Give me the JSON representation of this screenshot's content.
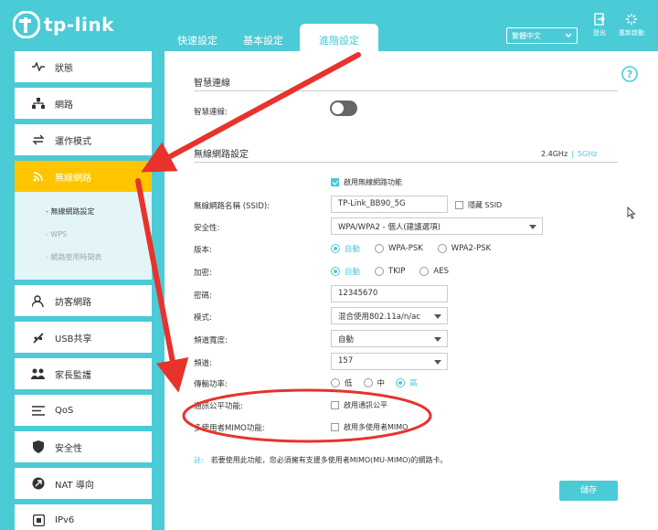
{
  "header": {
    "brand": "tp-link",
    "tabs": [
      "快速設定",
      "基本設定",
      "進階設定"
    ],
    "language": "繁體中文",
    "logout_label": "登出",
    "reboot_label": "重新啟動"
  },
  "sidebar": {
    "items": [
      {
        "label": "狀態",
        "icon": "pulse-icon"
      },
      {
        "label": "網路",
        "icon": "network-icon"
      },
      {
        "label": "運作模式",
        "icon": "mode-icon"
      },
      {
        "label": "無線網路",
        "icon": "wifi-icon"
      },
      {
        "label": "訪客網路",
        "icon": "guest-icon"
      },
      {
        "label": "USB共享",
        "icon": "usb-icon"
      },
      {
        "label": "家長監護",
        "icon": "parental-icon"
      },
      {
        "label": "QoS",
        "icon": "qos-icon"
      },
      {
        "label": "安全性",
        "icon": "shield-icon"
      },
      {
        "label": "NAT 導向",
        "icon": "nat-icon"
      },
      {
        "label": "IPv6",
        "icon": "ipv6-icon"
      }
    ],
    "submenu": [
      "- 無線網路設定",
      "- WPS",
      "- 網路使用時間表"
    ]
  },
  "smart_connect": {
    "title": "智慧連線",
    "label": "智慧連線:"
  },
  "wireless": {
    "title": "無線網路設定",
    "band_24": "2.4GHz",
    "band_sep": "|",
    "band_5": "5GHz",
    "enable_label": "啟用無線網路功能",
    "ssid_label": "無線網路名稱 (SSID):",
    "ssid_value": "TP-Link_BB90_5G",
    "hide_ssid_label": "隱藏 SSID",
    "security_label": "安全性:",
    "security_value": "WPA/WPA2 - 個人(建議選項)",
    "version_label": "版本:",
    "version_options": [
      "自動",
      "WPA-PSK",
      "WPA2-PSK"
    ],
    "encryption_label": "加密:",
    "encryption_options": [
      "自動",
      "TKIP",
      "AES"
    ],
    "password_label": "密碼:",
    "password_value": "12345670",
    "mode_label": "模式:",
    "mode_value": "混合使用802.11a/n/ac",
    "width_label": "頻道寬度:",
    "width_value": "自動",
    "channel_label": "頻道:",
    "channel_value": "157",
    "power_label": "傳輸功率:",
    "power_options": [
      "低",
      "中",
      "高"
    ],
    "airtime_label": "通訊公平功能:",
    "airtime_check": "啟用通訊公平",
    "mumimo_label": "多使用者MIMO功能:",
    "mumimo_check": "啟用多使用者MIMO"
  },
  "note": {
    "prefix": "註:",
    "text": "若要使用此功能，您必須擁有支援多使用者MIMO(MU-MIMO)的網路卡。"
  },
  "save_label": "儲存",
  "colors": {
    "accent": "#4acbd6",
    "active_menu": "#ffc600",
    "annotation": "#e8322c"
  }
}
